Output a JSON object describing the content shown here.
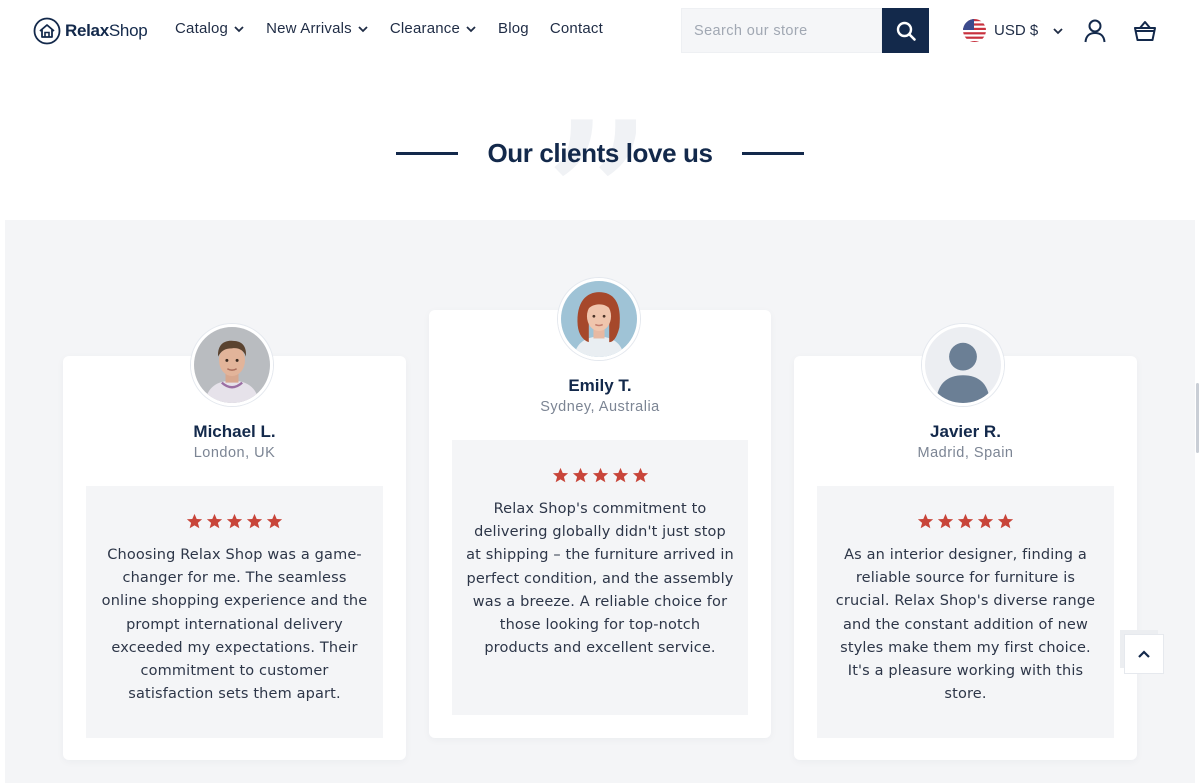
{
  "header": {
    "logo_bold": "Relax",
    "logo_rest": "Shop",
    "nav": [
      {
        "label": "Catalog",
        "has_dropdown": true
      },
      {
        "label": "New Arrivals",
        "has_dropdown": true
      },
      {
        "label": "Clearance",
        "has_dropdown": true
      },
      {
        "label": "Blog",
        "has_dropdown": false
      },
      {
        "label": "Contact",
        "has_dropdown": false
      }
    ],
    "search": {
      "placeholder": "Search our store",
      "value": ""
    },
    "currency": "USD $",
    "icons": {
      "logo": "house-icon",
      "search": "search-icon",
      "flag": "us-flag-icon",
      "currency_dropdown": "chevron-down-icon",
      "account": "user-icon",
      "cart": "shopping-basket-icon"
    }
  },
  "section": {
    "title": "Our clients love us",
    "decoration_icon": "quote-icon"
  },
  "testimonials": [
    {
      "name": "Michael L.",
      "location": "London, UK",
      "rating": 5,
      "avatar": "photo-man-avatar",
      "text": "Choosing Relax Shop was a game-changer for me. The seamless online shopping experience and the prompt international delivery exceeded my expectations. Their commitment to customer satisfaction sets them apart."
    },
    {
      "name": "Emily T.",
      "location": "Sydney, Australia",
      "rating": 5,
      "avatar": "photo-woman-avatar",
      "text": "Relax Shop's commitment to delivering globally didn't just stop at shipping – the furniture arrived in perfect condition, and the assembly was a breeze. A reliable choice for those looking for top-notch products and excellent service."
    },
    {
      "name": "Javier R.",
      "location": "Madrid, Spain",
      "rating": 5,
      "avatar": "default-user-avatar",
      "text": "As an interior designer, finding a reliable source for furniture is crucial. Relax Shop's diverse range and the constant addition of new styles make them my first choice. It's a pleasure working with this store."
    }
  ],
  "back_to_top_icon": "chevron-up-icon",
  "colors": {
    "primary": "#13294b",
    "star": "#c8453a",
    "section_bg": "#f4f5f7",
    "card_bg": "#ffffff"
  }
}
